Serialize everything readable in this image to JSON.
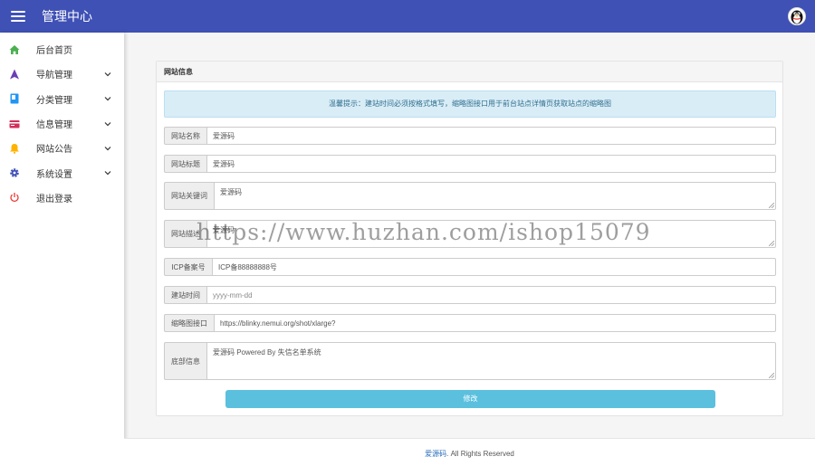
{
  "app": {
    "title": "管理中心"
  },
  "sidebar": {
    "items": [
      {
        "label": "后台首页",
        "icon": "home-icon",
        "color": "#4caf50",
        "expandable": false
      },
      {
        "label": "导航管理",
        "icon": "navigation-arrow-icon",
        "color": "#6a3fb5",
        "expandable": true
      },
      {
        "label": "分类管理",
        "icon": "category-book-icon",
        "color": "#2196f3",
        "expandable": true
      },
      {
        "label": "信息管理",
        "icon": "card-icon",
        "color": "#d32f5a",
        "expandable": true
      },
      {
        "label": "网站公告",
        "icon": "bell-icon",
        "color": "#ffb300",
        "expandable": true
      },
      {
        "label": "系统设置",
        "icon": "gear-icon",
        "color": "#3f51b5",
        "expandable": true
      },
      {
        "label": "退出登录",
        "icon": "power-icon",
        "color": "#e53935",
        "expandable": false
      }
    ]
  },
  "panel": {
    "title": "网站信息",
    "notice": "温馨提示：建站时间必须按格式填写，缩略图接口用于前台站点详情页获取站点的缩略图",
    "fields": {
      "site_name": {
        "label": "网站名称",
        "value": "爱源码"
      },
      "site_title": {
        "label": "网站标题",
        "value": "爱源码"
      },
      "keywords": {
        "label": "网站关键词",
        "value": "爱源码"
      },
      "description": {
        "label": "网站描述",
        "value": "爱源码"
      },
      "icp": {
        "label": "ICP备案号",
        "value": "ICP备88888888号"
      },
      "build_time": {
        "label": "建站时间",
        "placeholder": "yyyy-mm-dd"
      },
      "thumb_api": {
        "label": "缩略图接口",
        "value": "https://blinky.nemui.org/shot/xlarge?"
      },
      "footer_info": {
        "label": "底部信息",
        "value": "爱源码 Powered By 失信名单系统"
      }
    },
    "submit_label": "修改"
  },
  "footer": {
    "brand": "爱源码",
    "rights": ". All Rights Reserved"
  },
  "watermark": "https://www.huzhan.com/ishop15079",
  "colors": {
    "topbar": "#3f51b5",
    "notice_bg": "#d9edf7",
    "button": "#5bc0de"
  }
}
